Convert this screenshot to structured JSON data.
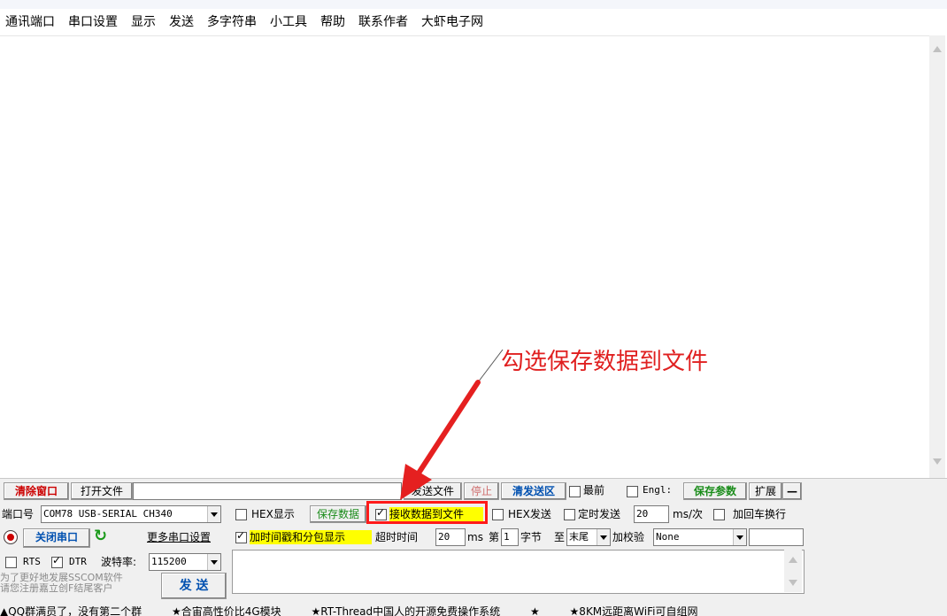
{
  "menu": [
    "通讯端口",
    "串口设置",
    "显示",
    "发送",
    "多字符串",
    "小工具",
    "帮助",
    "联系作者",
    "大虾电子网"
  ],
  "toolbar": {
    "clear_window": "清除窗口",
    "open_file": "打开文件",
    "send_file": "发送文件",
    "stop": "停止",
    "clear_send": "清发送区",
    "topmost": "最前",
    "english": "Engl:",
    "save_params": "保存参数",
    "expand": "扩展",
    "collapse": "—"
  },
  "port": {
    "label": "端口号",
    "value": "COM78 USB-SERIAL CH340",
    "close_button": "关闭串口",
    "more_settings": "更多串口设置",
    "rts": "RTS",
    "dtr": "DTR",
    "baud_label": "波特率:",
    "baud_value": "115200"
  },
  "options": {
    "hex_display": "HEX显示",
    "save_data": "保存数据",
    "recv_to_file": "接收数据到文件",
    "timestamp": "加时间戳和分包显示",
    "timeout_label": "超时时间",
    "timeout_value": "20",
    "ms": "ms",
    "nth_label": "第",
    "nth_value": "1",
    "byte_label": "字节",
    "to_label": "至",
    "end_value": "末尾",
    "checksum_label": "加校验",
    "checksum_value": "None",
    "hex_send": "HEX发送",
    "timed_send": "定时发送",
    "interval_value": "20",
    "interval_unit": "ms/次",
    "add_crlf": "加回车换行"
  },
  "promo": {
    "line1": "为了更好地发展SSCOM软件",
    "line2": "请您注册嘉立创F结尾客户",
    "send_button": "发 送"
  },
  "annotation": "勾选保存数据到文件",
  "status": [
    "▲QQ群满员了，没有第二个群",
    "★合宙高性价比4G模块",
    "★RT-Thread中国人的开源免费操作系统",
    "★",
    "★8KM远距离WiFi可自组网"
  ]
}
